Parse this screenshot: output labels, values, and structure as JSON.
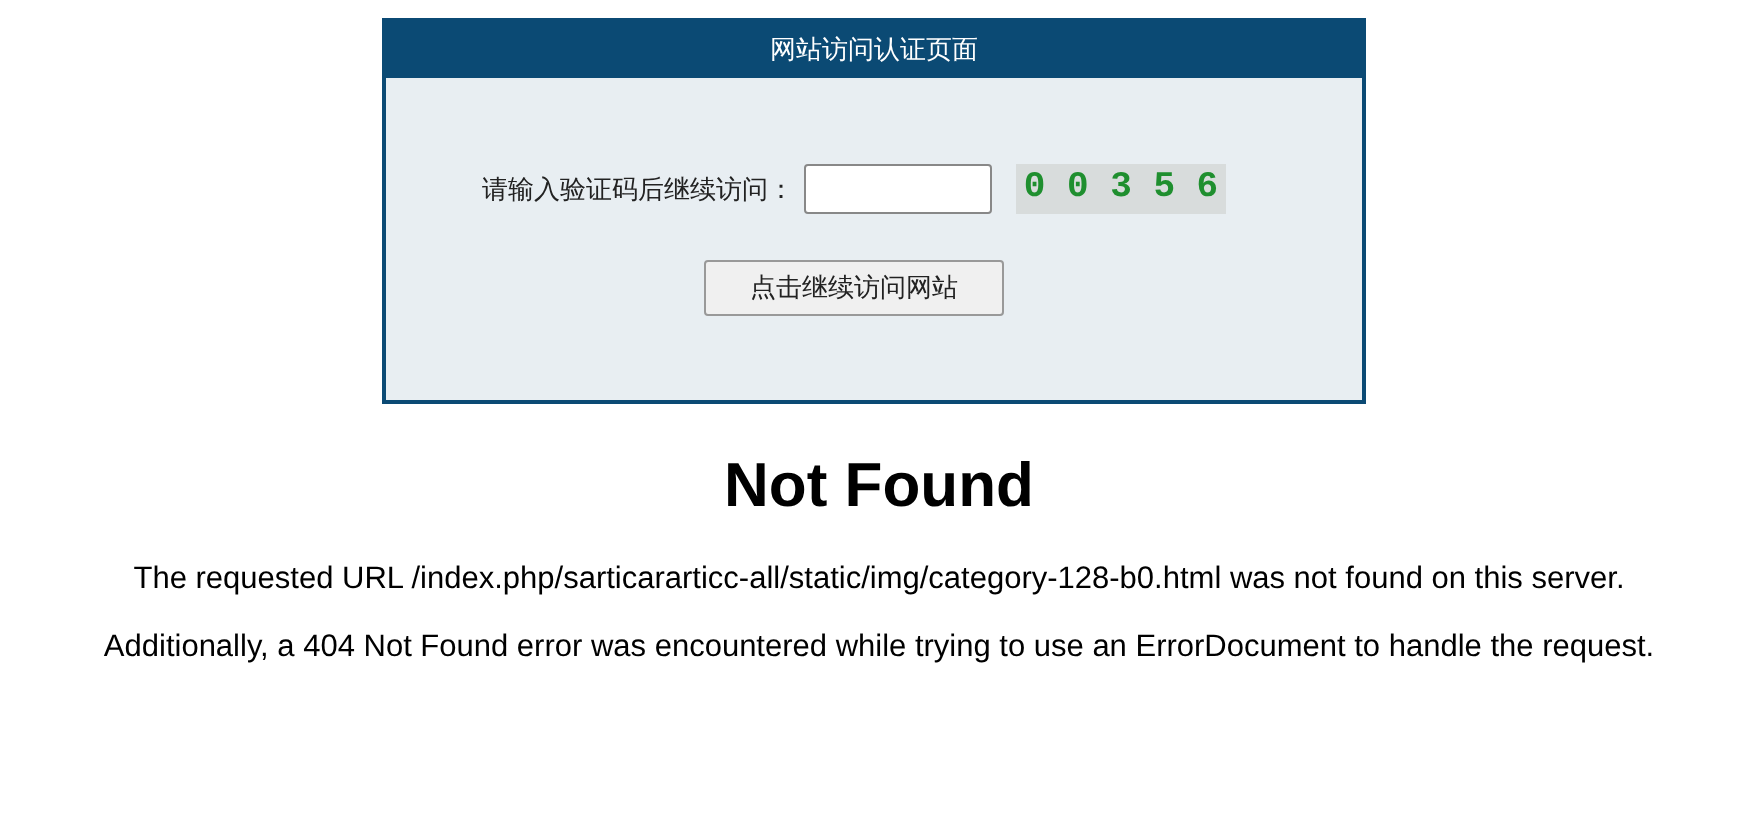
{
  "auth_panel": {
    "title": "网站访问认证页面",
    "prompt": "请输入验证码后继续访问：",
    "captcha": "0 0 3 5 6",
    "button": "点击继续访问网站"
  },
  "error": {
    "heading": "Not Found",
    "messages": [
      "The requested URL /index.php/sarticararticc-all/static/img/category-128-b0.html was not found on this server.",
      "Additionally, a 404 Not Found error was encountered while trying to use an ErrorDocument to handle the request."
    ]
  }
}
